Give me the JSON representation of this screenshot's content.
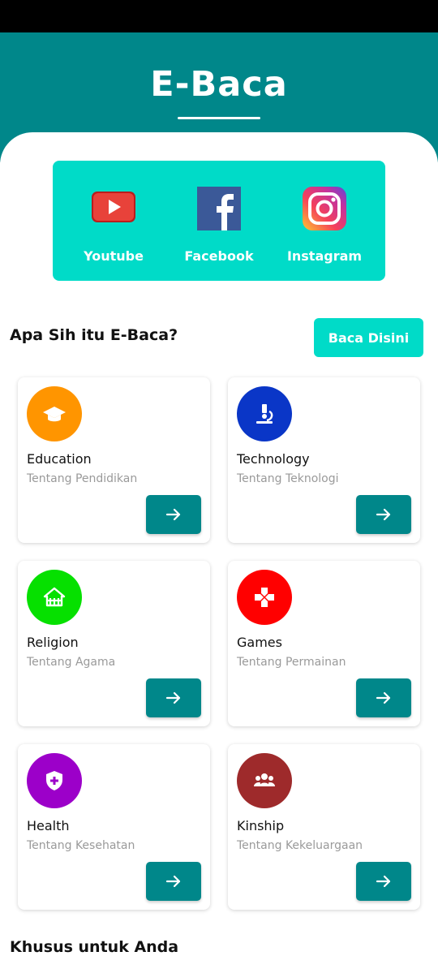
{
  "app": {
    "title": "E-Baca"
  },
  "social": {
    "items": [
      {
        "label": "Youtube",
        "icon": "youtube-icon"
      },
      {
        "label": "Facebook",
        "icon": "facebook-icon"
      },
      {
        "label": "Instagram",
        "icon": "instagram-icon"
      }
    ]
  },
  "about": {
    "title": "Apa Sih itu E-Baca?",
    "button_label": "Baca Disini"
  },
  "categories": [
    {
      "title": "Education",
      "subtitle": "Tentang Pendidikan",
      "color": "#ff9500",
      "icon": "graduation-cap-icon"
    },
    {
      "title": "Technology",
      "subtitle": "Tentang Teknologi",
      "color": "#0a36c7",
      "icon": "microscope-icon"
    },
    {
      "title": "Religion",
      "subtitle": "Tentang Agama",
      "color": "#06e000",
      "icon": "place-of-worship-icon"
    },
    {
      "title": "Games",
      "subtitle": "Tentang Permainan",
      "color": "#ff0000",
      "icon": "gamepad-icon"
    },
    {
      "title": "Health",
      "subtitle": "Tentang Kesehatan",
      "color": "#9c00c9",
      "icon": "shield-plus-icon"
    },
    {
      "title": "Kinship",
      "subtitle": "Tentang Kekeluargaan",
      "color": "#9e2a2b",
      "icon": "group-icon"
    }
  ],
  "footer": {
    "title": "Khusus untuk Anda"
  }
}
